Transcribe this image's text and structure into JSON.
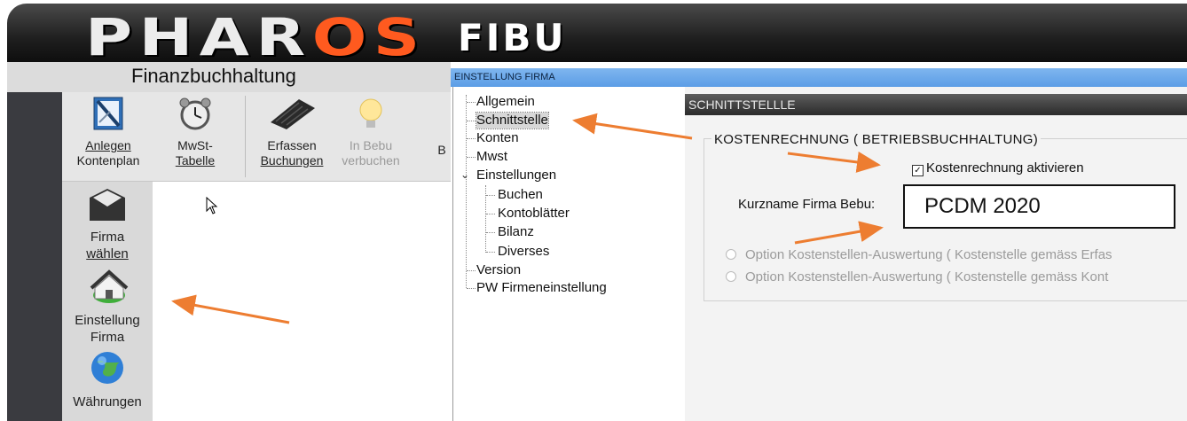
{
  "header": {
    "logo_main_left": "PHAR",
    "logo_main_accent": "OS",
    "logo_sub": "FIBU"
  },
  "app": {
    "title": "Finanzbuchhaltung"
  },
  "toolbar": {
    "items": [
      {
        "line1": "Anlegen",
        "line2": "Kontenplan",
        "icon": "ledger-icon",
        "disabled": false
      },
      {
        "line1": "MwSt-",
        "line2": "Tabelle",
        "icon": "alarm-clock-icon",
        "disabled": false
      },
      {
        "line1": "Erfassen",
        "line2": "Buchungen",
        "icon": "keyboard-icon",
        "disabled": false
      },
      {
        "line1": "In Bebu",
        "line2": "verbuchen",
        "icon": "lightbulb-icon",
        "disabled": true
      }
    ],
    "cut_label": "B"
  },
  "sidebar": {
    "items": [
      {
        "line1": "Firma",
        "line2": "wählen",
        "icon": "envelope-folder-icon"
      },
      {
        "line1": "Einstellung",
        "line2": "Firma",
        "icon": "house-settings-icon"
      },
      {
        "line1": "Währungen",
        "line2": "",
        "icon": "globe-icon"
      }
    ]
  },
  "dialog": {
    "title": "EINSTELLUNG FIRMA",
    "tree": [
      {
        "label": "Allgemein",
        "level": 0
      },
      {
        "label": "Schnittstelle",
        "level": 0,
        "selected": true
      },
      {
        "label": "Konten",
        "level": 0
      },
      {
        "label": "Mwst",
        "level": 0
      },
      {
        "label": "Einstellungen",
        "level": 0,
        "expanded": true
      },
      {
        "label": "Buchen",
        "level": 1
      },
      {
        "label": "Kontoblätter",
        "level": 1
      },
      {
        "label": "Bilanz",
        "level": 1
      },
      {
        "label": "Diverses",
        "level": 1
      },
      {
        "label": "Version",
        "level": 0
      },
      {
        "label": "PW Firmeneinstellung",
        "level": 0
      }
    ],
    "section_title": "SCHNITTSTELLLE",
    "group_title": "KOSTENRECHNUNG  ( BETRIEBSBUCHHALTUNG)",
    "checkbox_label": "Kostenrechnung aktivieren",
    "checkbox_checked": true,
    "field_label": "Kurzname Firma Bebu:",
    "field_value": "PCDM 2020",
    "radio_options": [
      "Option Kostenstellen-Auswertung  ( Kostenstelle gemäss Erfas",
      "Option Kostenstellen-Auswertung  ( Kostenstelle gemäss Kont"
    ]
  },
  "colors": {
    "accent_orange": "#ed7d31",
    "dialog_title_blue": "#5b9de6",
    "logo_orange": "#ff5a1f"
  }
}
